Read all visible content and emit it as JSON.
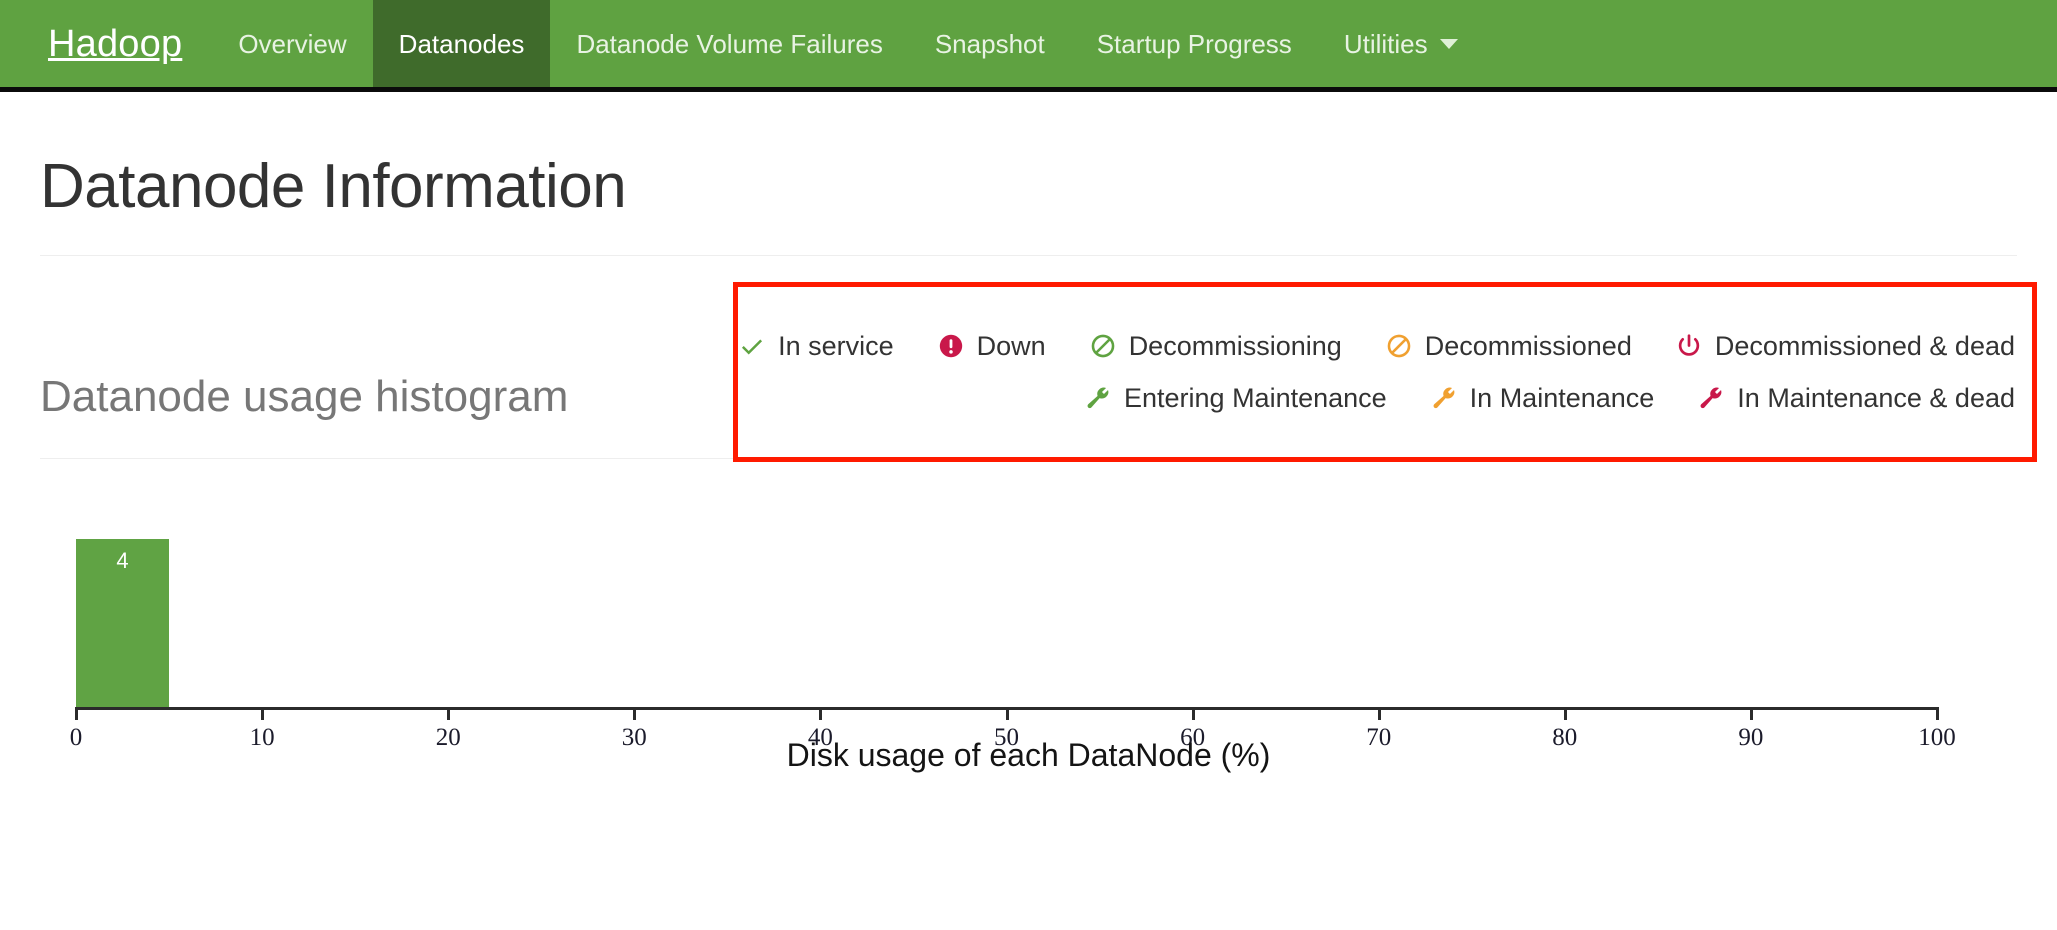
{
  "navbar": {
    "brand": "Hadoop",
    "items": [
      {
        "label": "Overview",
        "active": false,
        "caret": false
      },
      {
        "label": "Datanodes",
        "active": true,
        "caret": false
      },
      {
        "label": "Datanode Volume Failures",
        "active": false,
        "caret": false
      },
      {
        "label": "Snapshot",
        "active": false,
        "caret": false
      },
      {
        "label": "Startup Progress",
        "active": false,
        "caret": false
      },
      {
        "label": "Utilities",
        "active": false,
        "caret": true
      }
    ],
    "bg_color": "#5FA241",
    "active_bg_color": "#3F6B2B"
  },
  "page": {
    "title": "Datanode Information",
    "section_title": "Datanode usage histogram"
  },
  "legend": {
    "highlight_color": "#FF1A00",
    "rows": [
      [
        {
          "icon": "check-icon",
          "label": "In service",
          "color": "#5FA341"
        },
        {
          "icon": "exclamation-circle-icon",
          "label": "Down",
          "color": "#C9184A"
        },
        {
          "icon": "ban-circle-icon",
          "label": "Decommissioning",
          "color": "#5FA341"
        },
        {
          "icon": "ban-circle-icon",
          "label": "Decommissioned",
          "color": "#F0A030"
        },
        {
          "icon": "power-off-icon",
          "label": "Decommissioned & dead",
          "color": "#C9184A"
        }
      ],
      [
        {
          "icon": "wrench-icon",
          "label": "Entering Maintenance",
          "color": "#5FA341"
        },
        {
          "icon": "wrench-icon",
          "label": "In Maintenance",
          "color": "#F0A030"
        },
        {
          "icon": "wrench-icon",
          "label": "In Maintenance & dead",
          "color": "#C9184A"
        }
      ]
    ]
  },
  "chart_data": {
    "type": "bar",
    "title": "Datanode usage histogram",
    "xlabel": "Disk usage of each DataNode (%)",
    "ylabel": "",
    "xlim": [
      0,
      100
    ],
    "ylim": [
      0,
      4
    ],
    "grid": false,
    "legend": "none",
    "bar_color": "#60A344",
    "xticks": [
      0,
      10,
      20,
      30,
      40,
      50,
      60,
      70,
      80,
      90,
      100
    ],
    "xtick_labels": [
      "0",
      "10",
      "20",
      "30",
      "40",
      "50",
      "60",
      "70",
      "80",
      "90",
      "100"
    ],
    "bins": [
      {
        "x_start": 0,
        "x_end": 5,
        "value": 4,
        "data_label": "4"
      }
    ],
    "categories": [
      "0-5"
    ],
    "values": [
      4
    ]
  }
}
